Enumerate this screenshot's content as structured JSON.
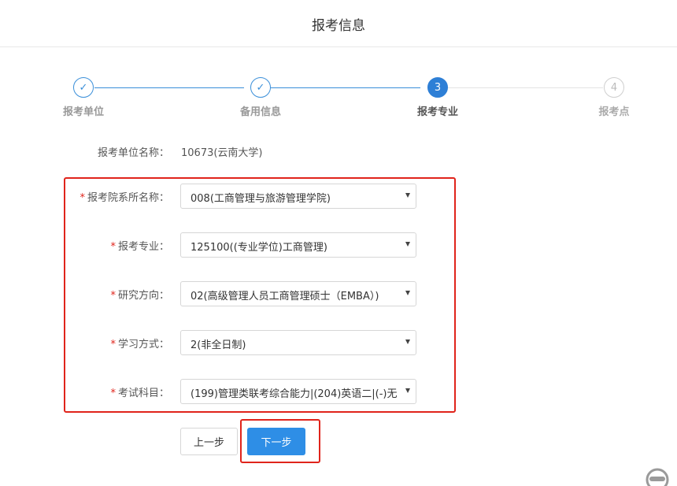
{
  "header": {
    "title": "报考信息"
  },
  "steps": [
    {
      "label": "报考单位",
      "state": "done",
      "marker": "✓"
    },
    {
      "label": "备用信息",
      "state": "done",
      "marker": "✓"
    },
    {
      "label": "报考专业",
      "state": "active",
      "marker": "3"
    },
    {
      "label": "报考点",
      "state": "todo",
      "marker": "4"
    }
  ],
  "unit": {
    "label": "报考单位名称：",
    "value": "10673(云南大学)"
  },
  "form": {
    "required_mark": "*",
    "fields": [
      {
        "label": "报考院系所名称：",
        "value": "008(工商管理与旅游管理学院)"
      },
      {
        "label": "报考专业：",
        "value": "125100((专业学位)工商管理)"
      },
      {
        "label": "研究方向：",
        "value": "02(高级管理人员工商管理硕士（EMBA）)"
      },
      {
        "label": "学习方式：",
        "value": "2(非全日制)"
      },
      {
        "label": "考试科目：",
        "value": "(199)管理类联考综合能力|(204)英语二|(-)无"
      }
    ]
  },
  "buttons": {
    "prev": "上一步",
    "next": "下一步"
  },
  "colors": {
    "primary": "#2e8ee6",
    "highlight_border": "#e0241b",
    "required": "#e0241b"
  }
}
